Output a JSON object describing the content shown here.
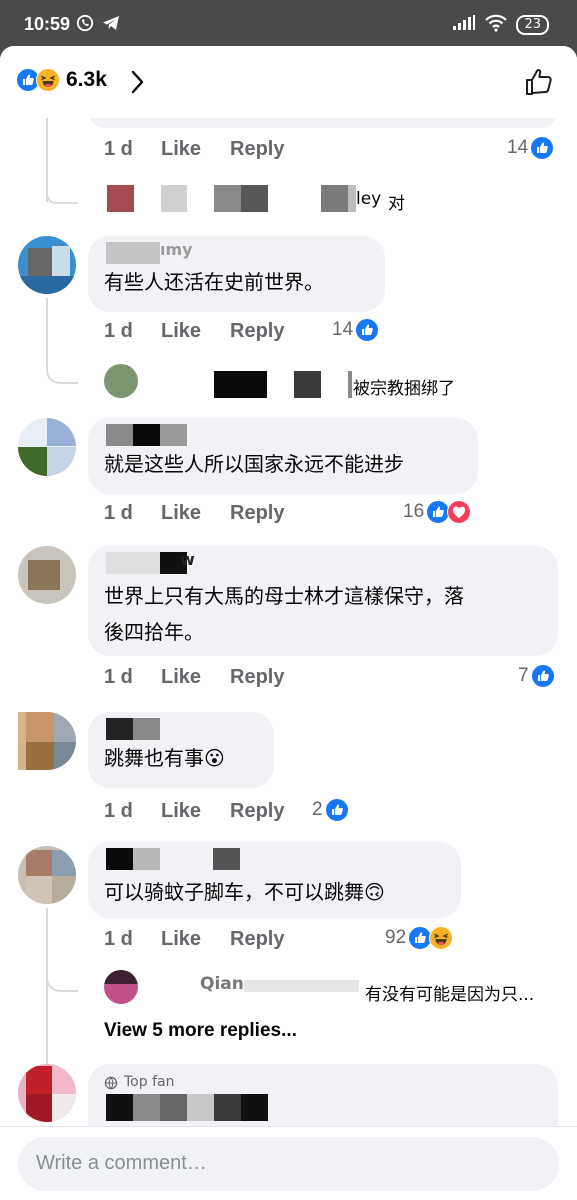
{
  "status_bar": {
    "time": "10:59",
    "battery": "23"
  },
  "header": {
    "reaction_count": "6.3k"
  },
  "comments": [
    {
      "meta": {
        "time": "1 d",
        "like": "Like",
        "reply": "Reply",
        "count": "14"
      },
      "reply_preview": {
        "name_tail": "ley",
        "text": "对"
      }
    },
    {
      "name_tail": "ımy",
      "text": "有些人还活在史前世界。",
      "meta": {
        "time": "1 d",
        "like": "Like",
        "reply": "Reply",
        "count": "14"
      },
      "reply_preview": {
        "text": "被宗教捆绑了"
      }
    },
    {
      "text": "就是这些人所以国家永远不能进步",
      "meta": {
        "time": "1 d",
        "like": "Like",
        "reply": "Reply",
        "count": "16"
      }
    },
    {
      "name_tail": "w",
      "text_line1": "世界上只有大馬的母士林才這樣保守，落",
      "text_line2": "後四拾年。",
      "meta": {
        "time": "1 d",
        "like": "Like",
        "reply": "Reply",
        "count": "7"
      }
    },
    {
      "text": "跳舞也有事😮",
      "meta": {
        "time": "1 d",
        "like": "Like",
        "reply": "Reply",
        "count": "2"
      }
    },
    {
      "text": "可以骑蚊子脚车，不可以跳舞🙃",
      "meta": {
        "time": "1 d",
        "like": "Like",
        "reply": "Reply",
        "count": "92"
      },
      "reply_preview": {
        "name": "Qian",
        "text": "有没有可能是因为只..."
      },
      "more_replies": "View 5 more replies..."
    },
    {
      "badge": "Top fan"
    }
  ],
  "composer": {
    "placeholder": "Write a comment…"
  },
  "colors": {
    "like_blue": "#1877f2",
    "love_red": "#f33e58",
    "haha_yellow": "#f7b125",
    "meta_gray": "#65676b",
    "bubble_bg": "#f0f2f5"
  }
}
